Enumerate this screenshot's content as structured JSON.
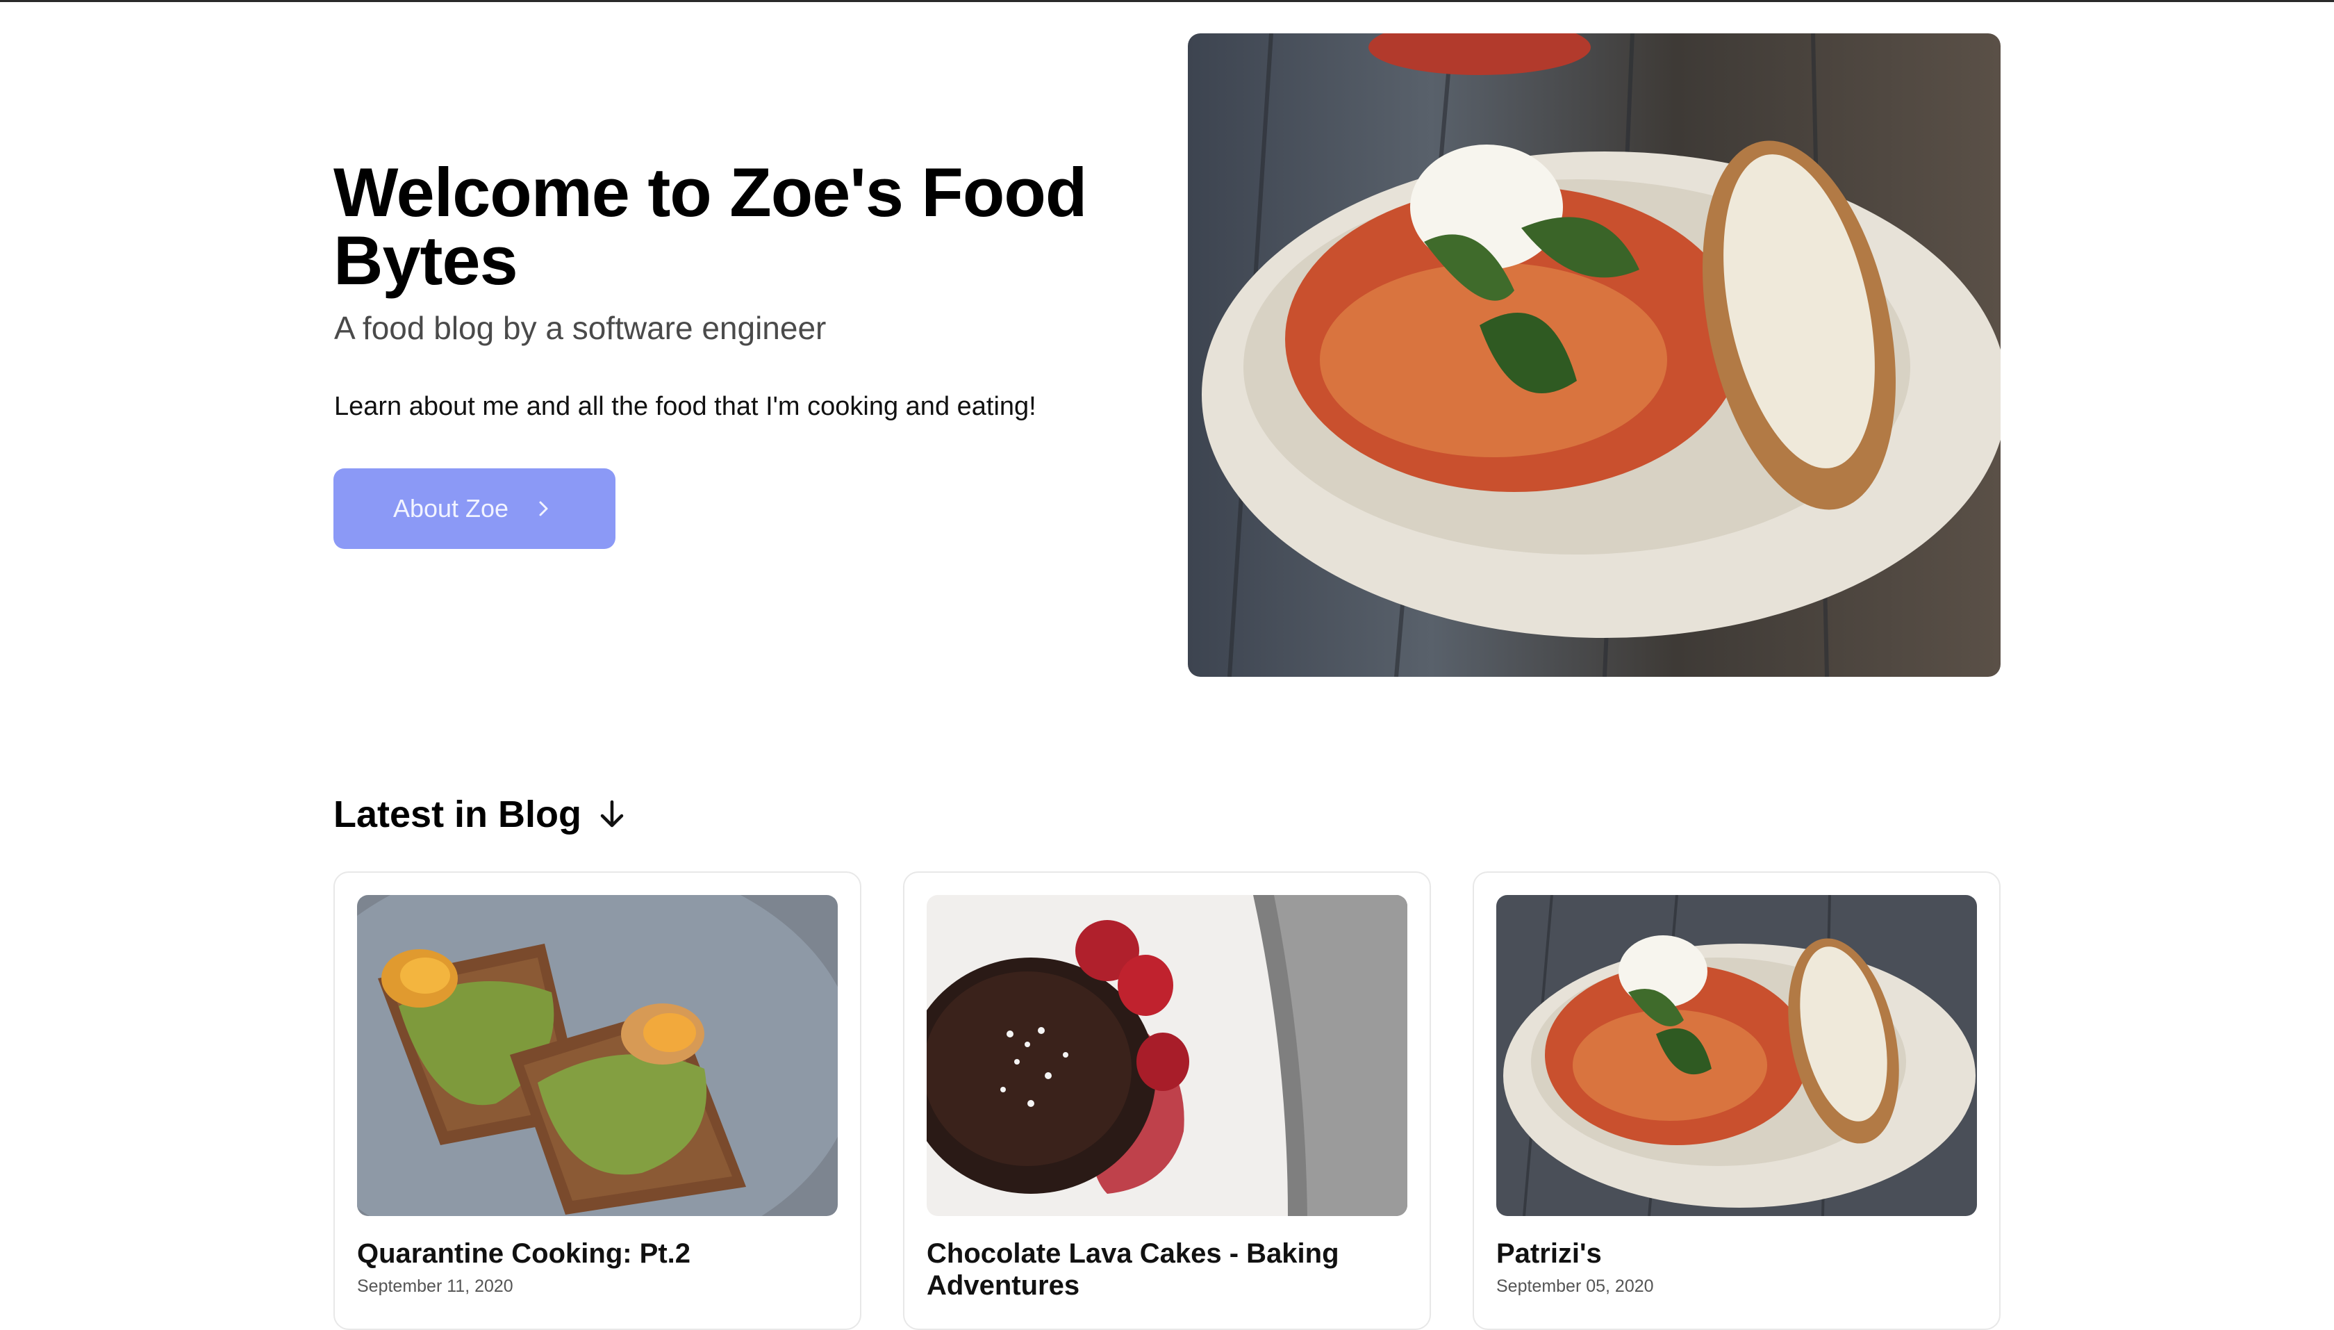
{
  "hero": {
    "title": "Welcome to Zoe's Food Bytes",
    "subtitle": "A food blog by a software engineer",
    "body": "Learn about me and all the food that I'm cooking and eating!",
    "button_label": "About Zoe",
    "button_icon": "chevron-right-icon",
    "button_color": "#8b99f6"
  },
  "blog": {
    "heading": "Latest in Blog",
    "heading_icon": "arrow-down-icon",
    "posts": [
      {
        "title": "Quarantine Cooking: Pt.2",
        "date": "September 11, 2020"
      },
      {
        "title": "Chocolate Lava Cakes - Baking Adventures",
        "date": ""
      },
      {
        "title": "Patrizi's",
        "date": "September 05, 2020"
      }
    ]
  }
}
